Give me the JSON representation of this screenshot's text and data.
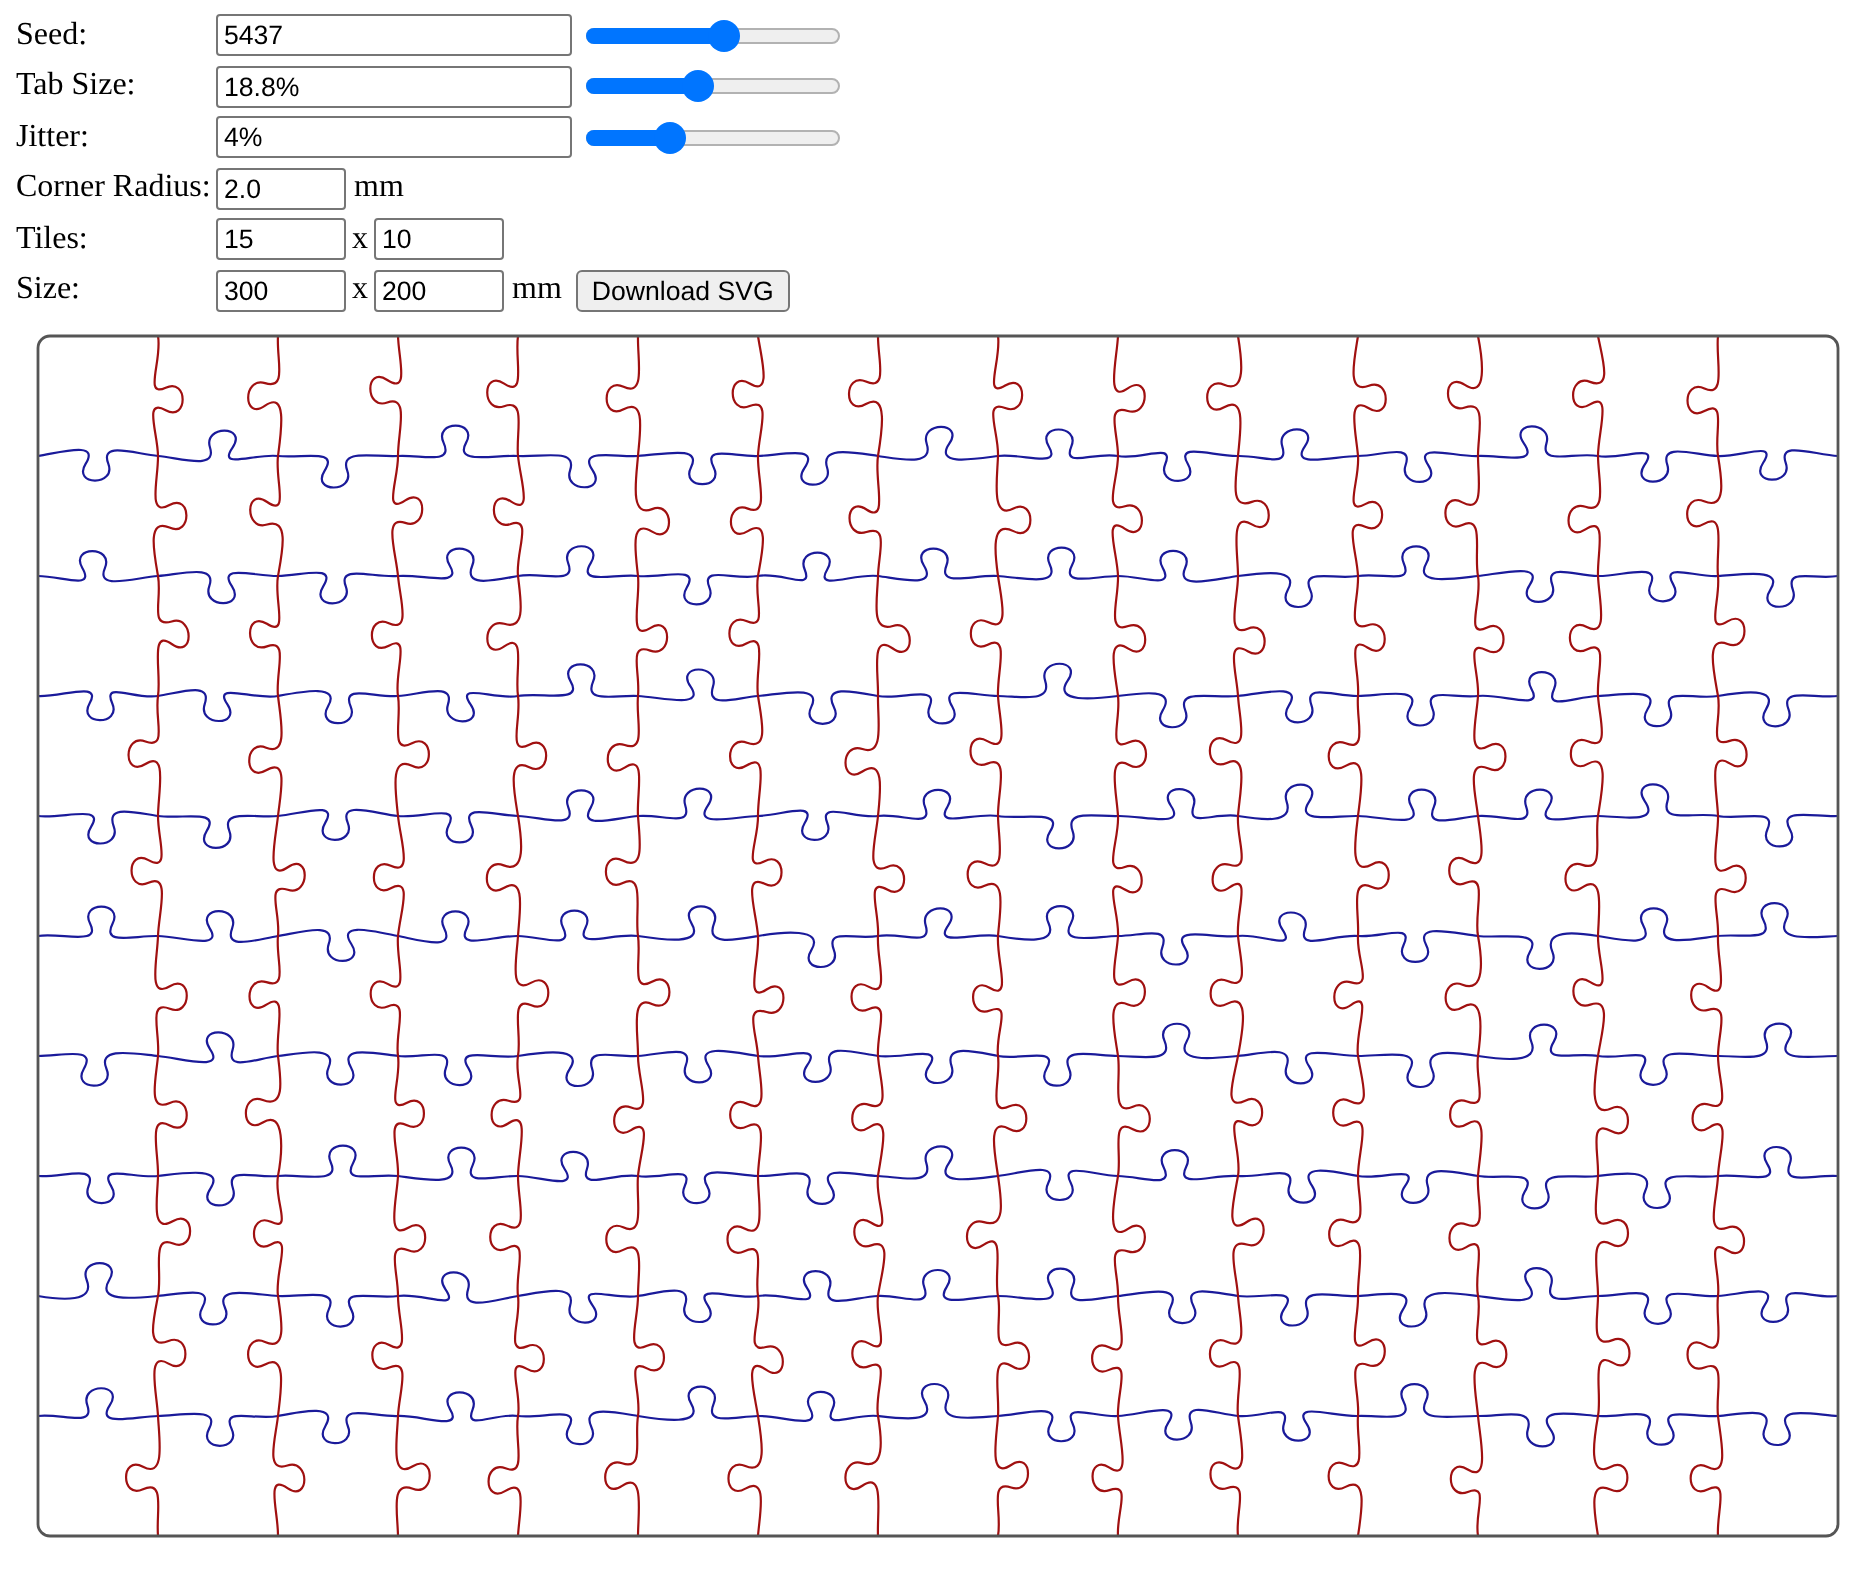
{
  "fields": [
    {
      "kind": "slider",
      "label": "Seed:",
      "value": "5437",
      "level": 0.54
    },
    {
      "kind": "slider",
      "label": "Tab Size:",
      "value": "18.8%",
      "level": 0.44
    },
    {
      "kind": "slider",
      "label": "Jitter:",
      "value": "4%",
      "level": 0.33
    },
    {
      "kind": "single",
      "label": "Corner Radius:",
      "value": "2.0",
      "unit": "mm"
    },
    {
      "kind": "pair",
      "label": "Tiles:",
      "value": "15",
      "separator": "x",
      "value_2": "10"
    },
    {
      "kind": "pair",
      "label": "Size:",
      "value": "300",
      "separator": "x",
      "value_2": "200",
      "unit": "mm",
      "button": "Download SVG"
    }
  ]
}
